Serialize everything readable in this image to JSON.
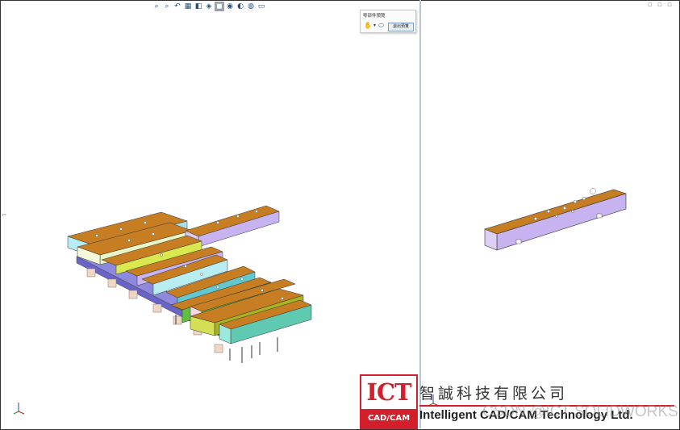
{
  "toolbar": {
    "buttons": [
      {
        "name": "zoom-to-fit-icon",
        "glyph": "⌕"
      },
      {
        "name": "zoom-area-icon",
        "glyph": "⌕"
      },
      {
        "name": "previous-view-icon",
        "glyph": "↶"
      },
      {
        "name": "section-view-icon",
        "glyph": "▦"
      },
      {
        "name": "dynamic-annotation-icon",
        "glyph": "◧"
      },
      {
        "name": "view-orientation-icon",
        "glyph": "◈"
      },
      {
        "name": "display-style-icon",
        "glyph": "◼"
      },
      {
        "name": "hide-show-items-icon",
        "glyph": "◉"
      },
      {
        "name": "edit-appearance-icon",
        "glyph": "◐"
      },
      {
        "name": "apply-scene-icon",
        "glyph": "◍"
      },
      {
        "name": "view-settings-icon",
        "glyph": "▭"
      }
    ]
  },
  "window_controls": [
    "▫",
    "▫",
    "▫"
  ],
  "popup": {
    "title": "零部件預覽",
    "button_label": "退出預覽"
  },
  "logo": {
    "top_text": "ICT",
    "bottom_text": "CAD/CAM"
  },
  "company": {
    "chinese_name": "智誠科技有限公司",
    "english_name": "Intelligent CAD/CAM Technology Ltd."
  },
  "watermark": "CSDN @ICT SOLIDWORKS",
  "colors": {
    "orange": "#c77e22",
    "lavender": "#c7b3ef",
    "lightblue": "#a9dfe9",
    "lime": "#d9e84f",
    "cyan": "#62c8cf",
    "green": "#5fbf44",
    "teal": "#5fc9b1",
    "brand_red": "#d21f2b"
  }
}
